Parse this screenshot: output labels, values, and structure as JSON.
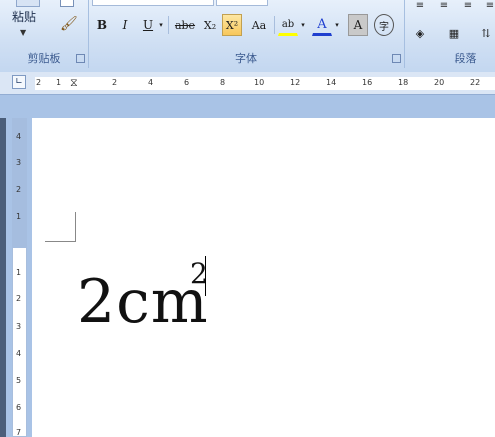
{
  "clipboard": {
    "paste_label": "粘贴",
    "group_label": "剪贴板"
  },
  "font": {
    "group_label": "字体"
  },
  "paragraph": {
    "group_label": "段落"
  },
  "buttons": {
    "bold": "B",
    "italic": "I",
    "underline": "U",
    "strike": "abe",
    "subscript": "X₂",
    "superscript": "X²",
    "case": "Aa",
    "highlight": "ab",
    "fontcolor": "A",
    "shade": "A",
    "phonetic": "字"
  },
  "ruler": {
    "h_ticks": [
      "2",
      "1",
      "2",
      "4",
      "6",
      "8",
      "10",
      "12",
      "14",
      "16",
      "18",
      "20",
      "22"
    ],
    "v_ticks": [
      "4",
      "3",
      "2",
      "1",
      "1",
      "2",
      "3",
      "4",
      "5",
      "6",
      "7"
    ]
  },
  "document": {
    "base_text": "2cm",
    "superscript": "2"
  },
  "colors": {
    "highlight": "#ffff00",
    "fontcolor": "#1f3fcf",
    "active": "#f8c75b"
  }
}
